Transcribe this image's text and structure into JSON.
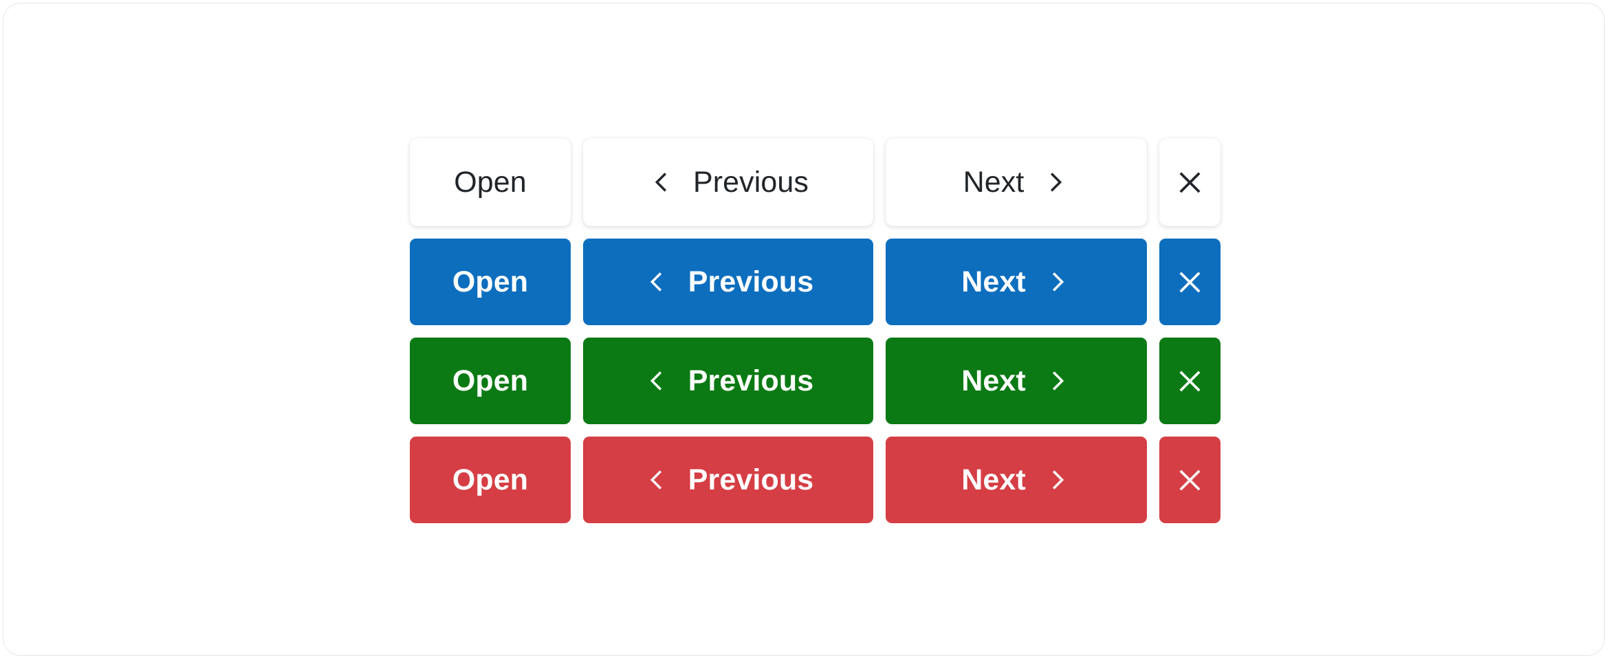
{
  "page": {
    "background": "#ffffff",
    "frame_border_color": "#e3e5e8"
  },
  "button_matrix": {
    "columns": [
      {
        "key": "open",
        "label": "Open",
        "icon": null,
        "icon_position": null
      },
      {
        "key": "previous",
        "label": "Previous",
        "icon": "chevron-left-icon",
        "icon_position": "leading"
      },
      {
        "key": "next",
        "label": "Next",
        "icon": "chevron-right-icon",
        "icon_position": "trailing"
      },
      {
        "key": "close",
        "label": "",
        "icon": "close-icon",
        "icon_position": "only"
      }
    ],
    "rows": [
      {
        "variant": "light",
        "background": "#ffffff",
        "text_color": "#212529",
        "font_weight": "regular",
        "buttons": {
          "open": "Open",
          "previous": "Previous",
          "next": "Next",
          "close": ""
        }
      },
      {
        "variant": "primary",
        "background": "#0d6ebe",
        "text_color": "#ffffff",
        "font_weight": "bold",
        "buttons": {
          "open": "Open",
          "previous": "Previous",
          "next": "Next",
          "close": ""
        }
      },
      {
        "variant": "success",
        "background": "#0b7a14",
        "text_color": "#ffffff",
        "font_weight": "bold",
        "buttons": {
          "open": "Open",
          "previous": "Previous",
          "next": "Next",
          "close": ""
        }
      },
      {
        "variant": "danger",
        "background": "#d53e44",
        "text_color": "#ffffff",
        "font_weight": "bold",
        "buttons": {
          "open": "Open",
          "previous": "Previous",
          "next": "Next",
          "close": ""
        }
      }
    ]
  }
}
